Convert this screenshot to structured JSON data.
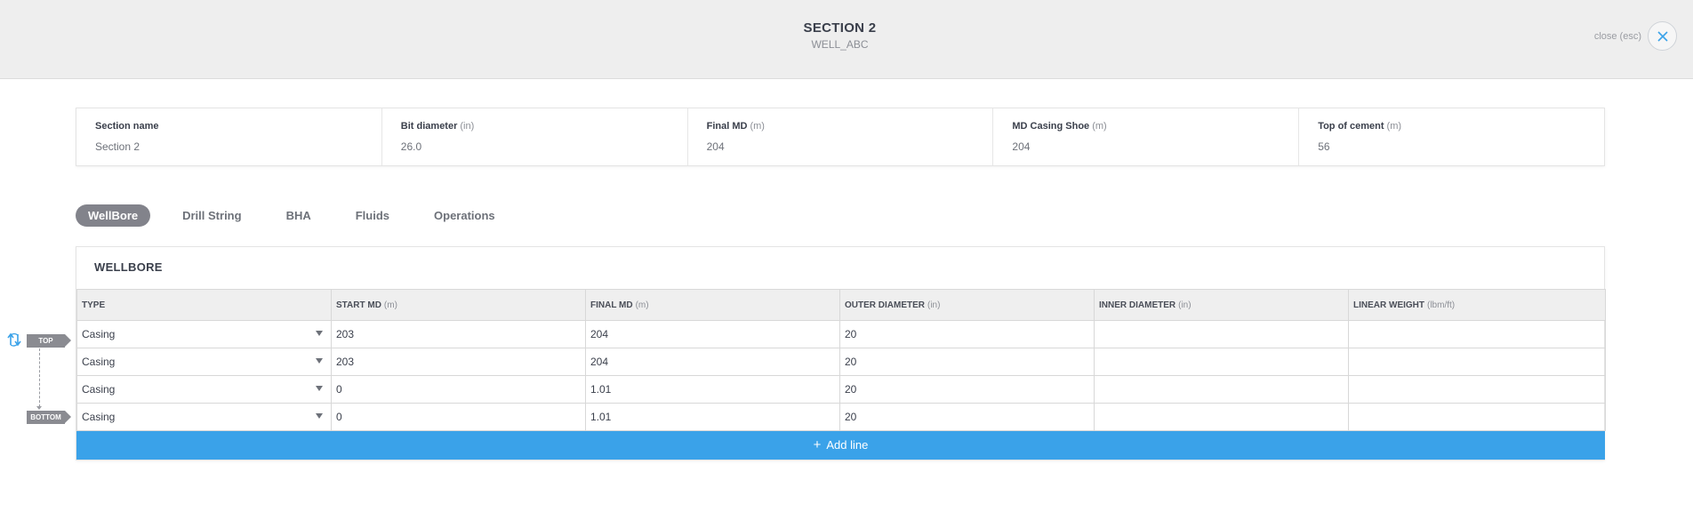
{
  "header": {
    "title": "SECTION 2",
    "subtitle": "WELL_ABC",
    "close_label": "close (esc)"
  },
  "summary": [
    {
      "label": "Section name",
      "unit": "",
      "value": "Section 2"
    },
    {
      "label": "Bit diameter",
      "unit": "(in)",
      "value": "26.0"
    },
    {
      "label": "Final MD",
      "unit": "(m)",
      "value": "204"
    },
    {
      "label": "MD Casing Shoe",
      "unit": "(m)",
      "value": "204"
    },
    {
      "label": "Top of cement",
      "unit": "(m)",
      "value": "56"
    }
  ],
  "tabs": [
    {
      "label": "WellBore",
      "active": true
    },
    {
      "label": "Drill String",
      "active": false
    },
    {
      "label": "BHA",
      "active": false
    },
    {
      "label": "Fluids",
      "active": false
    },
    {
      "label": "Operations",
      "active": false
    }
  ],
  "wellbore": {
    "title": "WELLBORE",
    "columns": [
      {
        "label": "TYPE",
        "unit": ""
      },
      {
        "label": "START MD",
        "unit": "(m)"
      },
      {
        "label": "FINAL MD",
        "unit": "(m)"
      },
      {
        "label": "OUTER DIAMETER",
        "unit": "(in)"
      },
      {
        "label": "INNER DIAMETER",
        "unit": "(in)"
      },
      {
        "label": "LINEAR WEIGHT",
        "unit": "(lbm/ft)"
      }
    ],
    "rows": [
      {
        "type": "Casing",
        "start_md": "203",
        "final_md": "204",
        "outer_diameter": "20",
        "inner_diameter": "",
        "linear_weight": ""
      },
      {
        "type": "Casing",
        "start_md": "203",
        "final_md": "204",
        "outer_diameter": "20",
        "inner_diameter": "",
        "linear_weight": ""
      },
      {
        "type": "Casing",
        "start_md": "0",
        "final_md": "1.01",
        "outer_diameter": "20",
        "inner_diameter": "",
        "linear_weight": ""
      },
      {
        "type": "Casing",
        "start_md": "0",
        "final_md": "1.01",
        "outer_diameter": "20",
        "inner_diameter": "",
        "linear_weight": ""
      }
    ],
    "add_line_label": "Add line"
  },
  "markers": {
    "top": "TOP",
    "bottom": "BOTTOM"
  },
  "colors": {
    "accent": "#3aa2e9",
    "tab_active_bg": "#82838b",
    "header_bg": "#eeeeee"
  }
}
